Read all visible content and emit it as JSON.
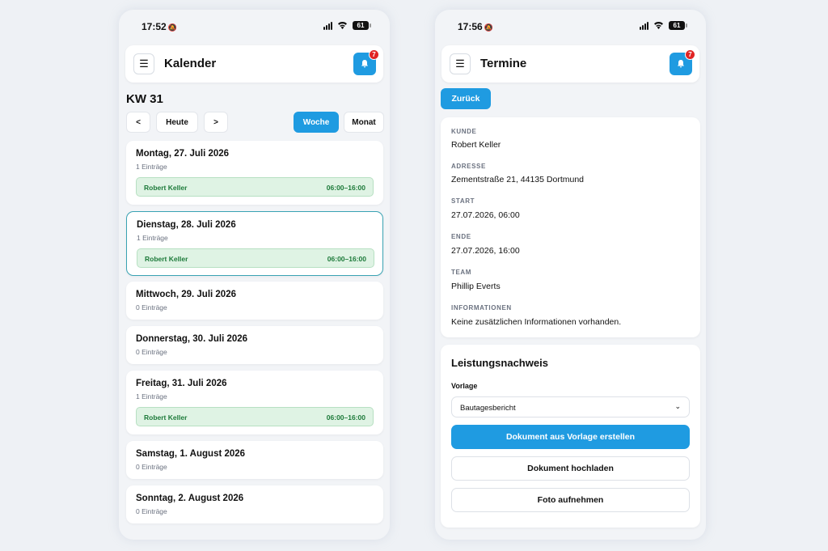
{
  "left": {
    "status": {
      "time": "17:52",
      "battery": "61"
    },
    "app_title": "Kalender",
    "notifications": "7",
    "week_label": "KW 31",
    "nav": {
      "prev": "<",
      "today": "Heute",
      "next": ">",
      "week": "Woche",
      "month": "Monat"
    },
    "days": [
      {
        "title": "Montag, 27. Juli 2026",
        "count": "1 Einträge",
        "entries": [
          {
            "name": "Robert Keller",
            "time": "06:00–16:00"
          }
        ]
      },
      {
        "title": "Dienstag, 28. Juli 2026",
        "count": "1 Einträge",
        "selected": true,
        "entries": [
          {
            "name": "Robert Keller",
            "time": "06:00–16:00"
          }
        ]
      },
      {
        "title": "Mittwoch, 29. Juli 2026",
        "count": "0 Einträge",
        "entries": []
      },
      {
        "title": "Donnerstag, 30. Juli 2026",
        "count": "0 Einträge",
        "entries": []
      },
      {
        "title": "Freitag, 31. Juli 2026",
        "count": "1 Einträge",
        "entries": [
          {
            "name": "Robert Keller",
            "time": "06:00–16:00"
          }
        ]
      },
      {
        "title": "Samstag, 1. August 2026",
        "count": "0 Einträge",
        "entries": []
      },
      {
        "title": "Sonntag, 2. August 2026",
        "count": "0 Einträge",
        "entries": []
      }
    ]
  },
  "right": {
    "status": {
      "time": "17:56",
      "battery": "61"
    },
    "app_title": "Termine",
    "notifications": "7",
    "back_label": "Zurück",
    "details": [
      {
        "label": "KUNDE",
        "value": "Robert Keller"
      },
      {
        "label": "ADRESSE",
        "value": "Zementstraße 21, 44135 Dortmund"
      },
      {
        "label": "START",
        "value": "27.07.2026, 06:00"
      },
      {
        "label": "ENDE",
        "value": "27.07.2026, 16:00"
      },
      {
        "label": "TEAM",
        "value": "Phillip Everts"
      },
      {
        "label": "INFORMATIONEN",
        "value": "Keine zusätzlichen Informationen vorhanden."
      }
    ],
    "proof": {
      "title": "Leistungsnachweis",
      "template_label": "Vorlage",
      "template_value": "Bautagesbericht",
      "create_label": "Dokument aus Vorlage erstellen",
      "upload_label": "Dokument hochladen",
      "photo_label": "Foto aufnehmen"
    }
  },
  "colors": {
    "accent": "#1f9be1",
    "badge": "#e02424",
    "entry_bg": "#dff3e4",
    "entry_text": "#1d7a3a"
  }
}
